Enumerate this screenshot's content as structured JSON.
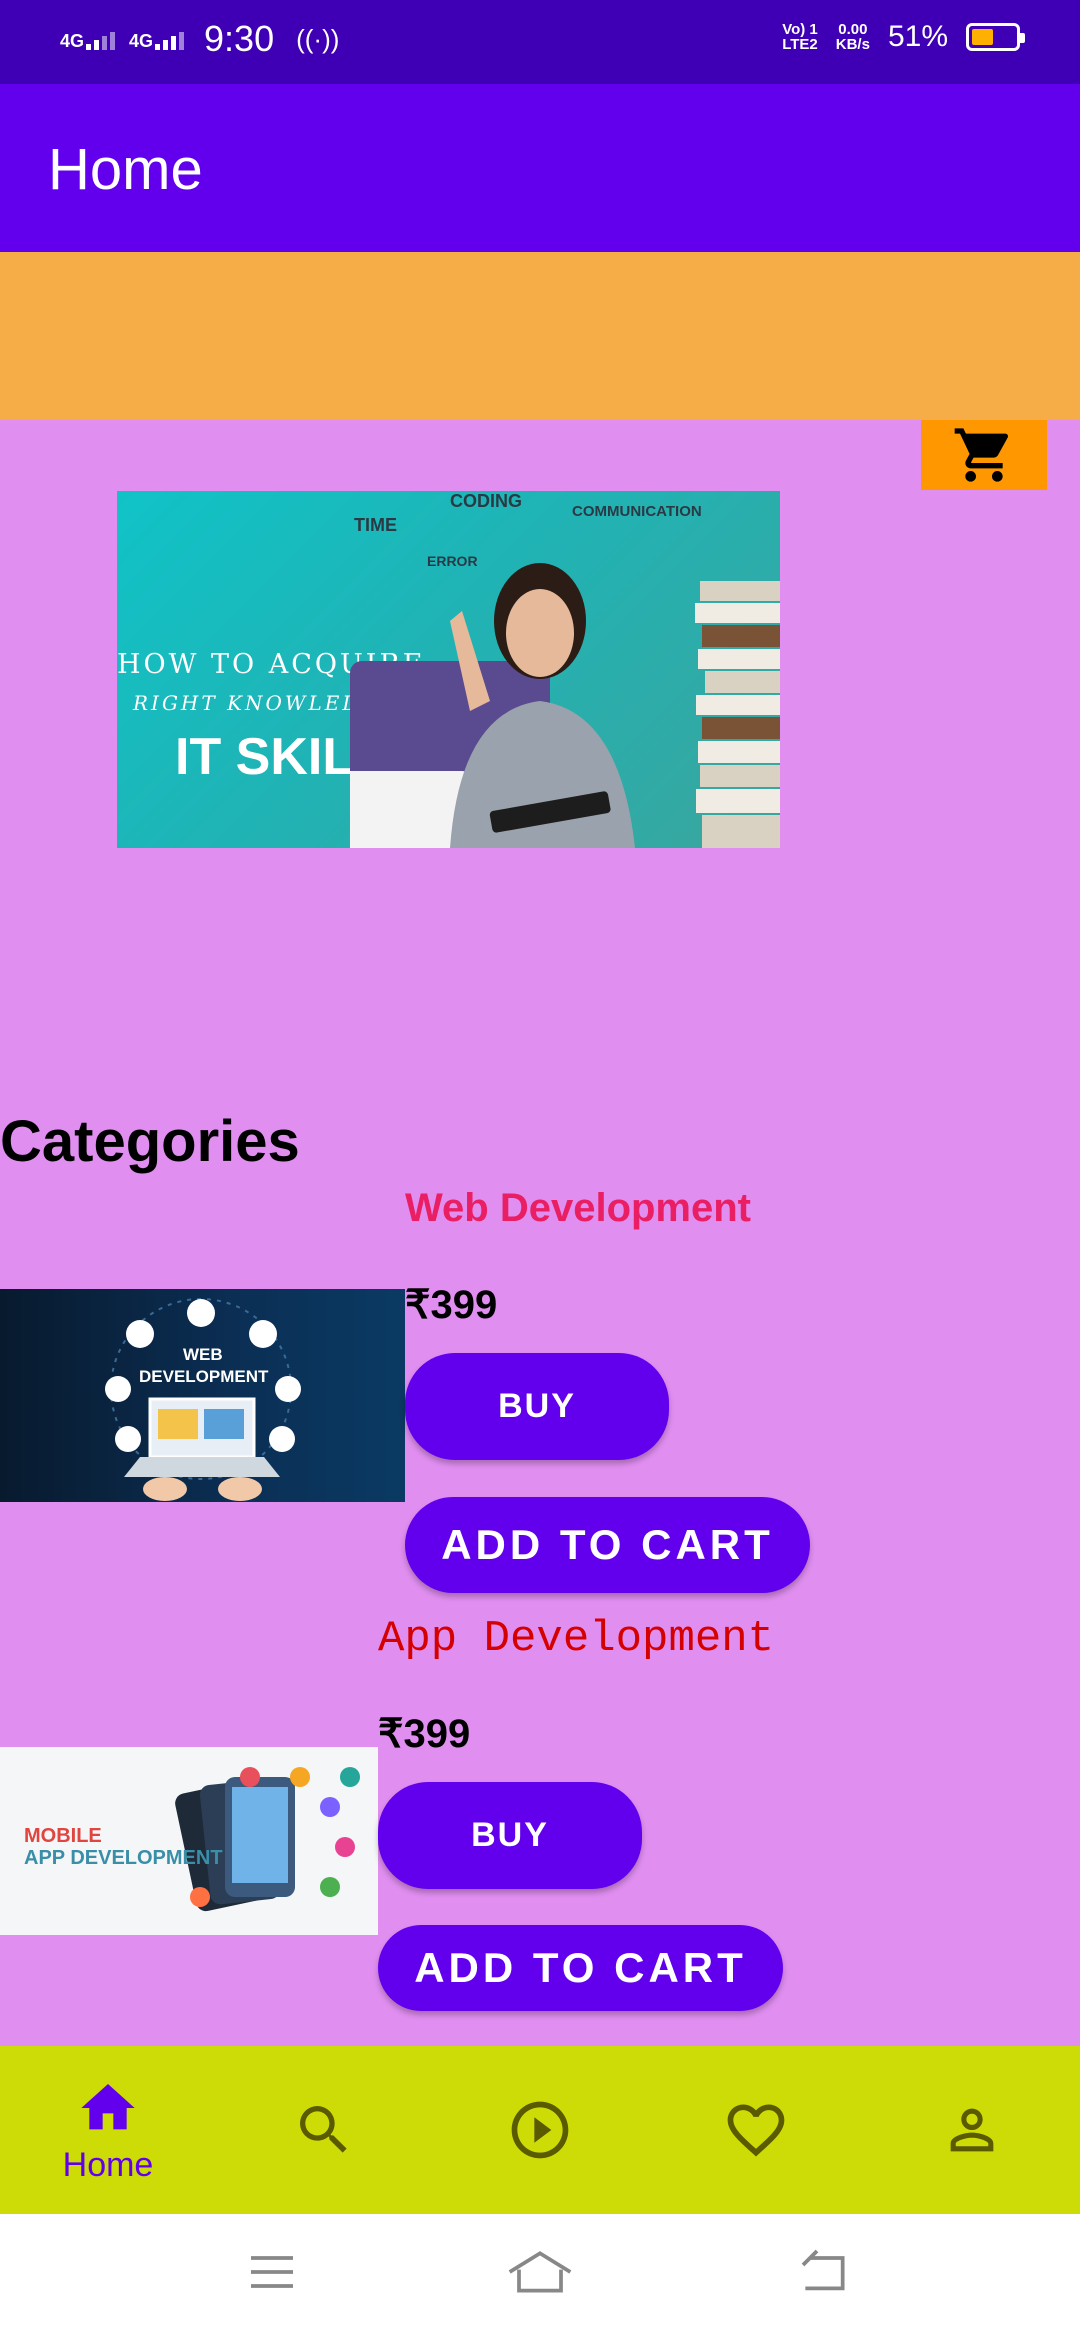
{
  "status": {
    "net1": "4G",
    "net2": "4G",
    "time": "9:30",
    "hotspot": "((·))",
    "volte_top": "Vo) 1",
    "volte_bottom": "LTE2",
    "speed_top": "0.00",
    "speed_bottom": "KB/s",
    "battery": "51%",
    "battery_level": 0.51
  },
  "appbar": {
    "title": "Home"
  },
  "banner": {
    "words": [
      "TIME",
      "CODING",
      "COMMUNICATION",
      "ERROR"
    ],
    "line1": "HOW TO ACQUIRE",
    "line2": "RIGHT KNOWLEDGE",
    "line3": "IT SKILLS"
  },
  "categories_title": "Categories",
  "courses": [
    {
      "name": "Web Development",
      "price": "₹399",
      "buy": "BUY",
      "add": "ADD TO CART",
      "img_line1": "WEB",
      "img_line2": "DEVELOPMENT"
    },
    {
      "name": "App Development",
      "price": "₹399",
      "buy": "BUY",
      "add": "ADD TO CART",
      "img_line1": "MOBILE",
      "img_line2": "APP DEVELOPMENT"
    }
  ],
  "bottom_nav": {
    "items": [
      {
        "icon": "home-icon",
        "label": "Home"
      },
      {
        "icon": "search-icon"
      },
      {
        "icon": "play-icon"
      },
      {
        "icon": "heart-icon"
      },
      {
        "icon": "profile-icon"
      }
    ]
  },
  "colors": {
    "primary": "#6200ee",
    "status_bar": "#3f00b5",
    "background": "#e18ef1",
    "strip": "#f6ad48",
    "cart": "#ff9800",
    "bottom_nav": "#cddc06",
    "web_title": "#e91e63",
    "app_title": "#d50000"
  }
}
